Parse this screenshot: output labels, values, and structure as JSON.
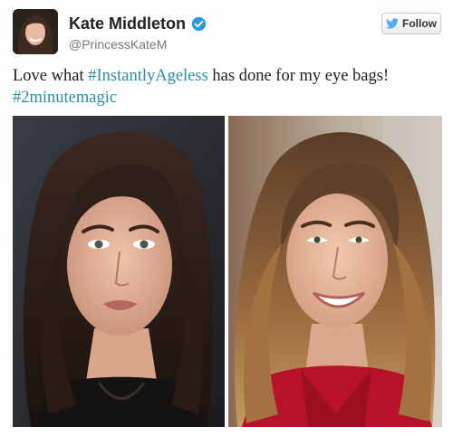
{
  "tweet": {
    "display_name": "Kate Middleton",
    "handle": "@PrincessKateM",
    "follow_label": "Follow",
    "text_part1": "Love what ",
    "hashtag1": "#InstantlyAgeless",
    "text_part2": " has done for my eye bags!",
    "hashtag2": "#2minutemagic"
  },
  "icons": {
    "verified": "verified-badge-icon",
    "follow": "twitter-bird-icon"
  },
  "colors": {
    "hashtag": "#2a8ea6",
    "verified": "#2b9ad8",
    "dress_red": "#b8122a"
  }
}
